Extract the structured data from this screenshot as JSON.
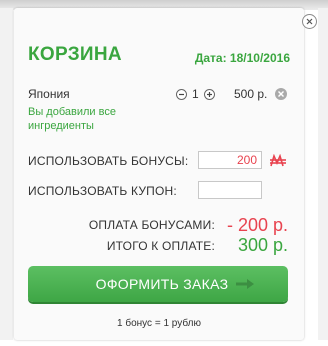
{
  "cart": {
    "title": "КОРЗИНА",
    "date": "Дата: 18/10/2016",
    "item": {
      "name": "Япония",
      "quantity": "1",
      "price": "500 р.",
      "note": "Вы добавили все ингредиенты"
    },
    "bonus": {
      "label": "ИСПОЛЬЗОВАТЬ БОНУСЫ:",
      "value": "200",
      "currency_icon": "ruble-icon"
    },
    "coupon": {
      "label": "ИСПОЛЬЗОВАТЬ КУПОН:",
      "value": ""
    },
    "summary": {
      "bonus_pay_label": "ОПЛАТА БОНУСАМИ:",
      "bonus_pay_value": "- 200 р.",
      "total_label": "ИТОГО К ОПЛАТЕ:",
      "total_value": "300 р."
    },
    "order_button": "ОФОРМИТЬ ЗАКАЗ",
    "footnote": "1 бонус = 1 рублю"
  },
  "colors": {
    "accent_green": "#3aa63f",
    "accent_red": "#e8434f",
    "button_green": "#4cb553"
  },
  "icons": [
    "close-icon",
    "minus-icon",
    "plus-icon",
    "remove-icon",
    "ruble-icon",
    "arrow-right-icon"
  ]
}
